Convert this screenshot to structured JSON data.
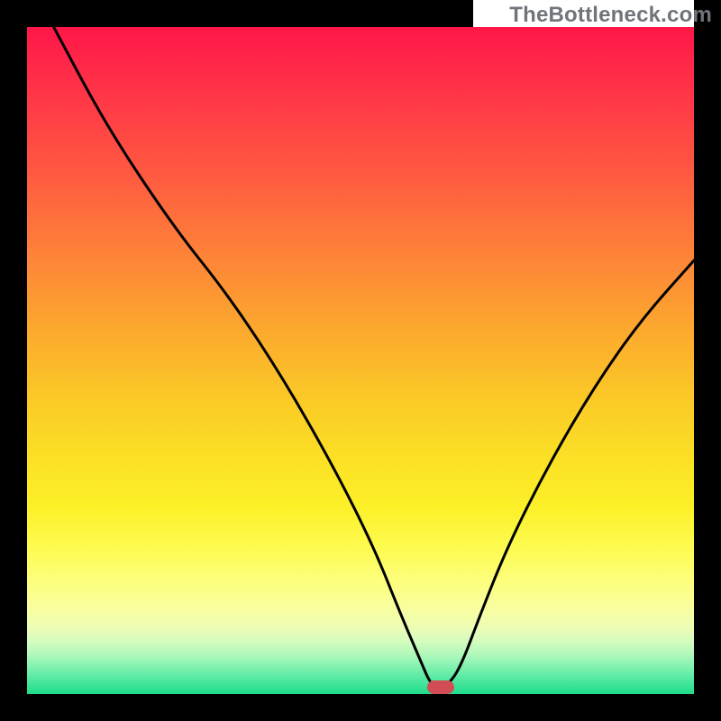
{
  "watermark": {
    "text": "TheBottleneck.com"
  },
  "chart_data": {
    "type": "line",
    "title": "",
    "xlabel": "",
    "ylabel": "",
    "xlim": [
      0,
      100
    ],
    "ylim": [
      0,
      100
    ],
    "curve": {
      "name": "bottleneck-curve",
      "x": [
        4,
        12,
        22,
        30,
        38,
        46,
        52,
        56,
        59,
        60.5,
        61.5,
        63,
        65,
        68,
        72,
        78,
        85,
        92,
        100
      ],
      "y": [
        100,
        85,
        70,
        60,
        48,
        34,
        22,
        12,
        5,
        1.5,
        1.2,
        1.2,
        4,
        12,
        22,
        34,
        46,
        56,
        65
      ]
    },
    "marker": {
      "x": 62,
      "y": 1,
      "color": "#d24c56"
    },
    "gradient_stops": [
      {
        "pos": 0,
        "color": "#ff1648"
      },
      {
        "pos": 8,
        "color": "#ff2f48"
      },
      {
        "pos": 20,
        "color": "#ff5342"
      },
      {
        "pos": 32,
        "color": "#fe7b3a"
      },
      {
        "pos": 44,
        "color": "#fca42f"
      },
      {
        "pos": 55,
        "color": "#fbc727"
      },
      {
        "pos": 65,
        "color": "#fbe125"
      },
      {
        "pos": 72,
        "color": "#fcf028"
      },
      {
        "pos": 78,
        "color": "#fdfb4f"
      },
      {
        "pos": 83,
        "color": "#fdfe7c"
      },
      {
        "pos": 87,
        "color": "#f9fe9e"
      },
      {
        "pos": 90,
        "color": "#eefdb5"
      },
      {
        "pos": 92,
        "color": "#d6fcbd"
      },
      {
        "pos": 94,
        "color": "#b2f8bb"
      },
      {
        "pos": 96,
        "color": "#80f1b0"
      },
      {
        "pos": 98,
        "color": "#4de79f"
      },
      {
        "pos": 100,
        "color": "#1fdd8a"
      }
    ]
  }
}
